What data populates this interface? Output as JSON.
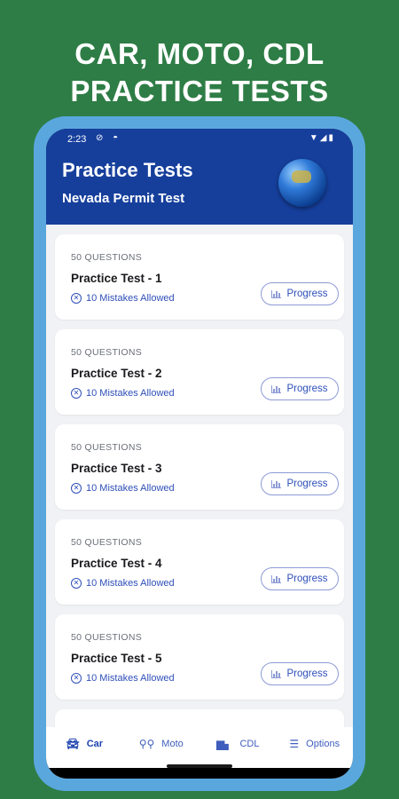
{
  "promo": {
    "line1": "CAR, MOTO, CDL",
    "line2": "PRACTICE TESTS"
  },
  "status_bar": {
    "time": "2:23",
    "left_icons": "⊘ ◓",
    "right_icons": "▼◢▮"
  },
  "header": {
    "title": "Practice Tests",
    "subtitle": "Nevada Permit Test"
  },
  "tests": [
    {
      "count": "50 QUESTIONS",
      "title": "Practice Test - 1",
      "mistakes": "10 Mistakes Allowed",
      "button": "Progress"
    },
    {
      "count": "50 QUESTIONS",
      "title": "Practice Test - 2",
      "mistakes": "10 Mistakes Allowed",
      "button": "Progress"
    },
    {
      "count": "50 QUESTIONS",
      "title": "Practice Test - 3",
      "mistakes": "10 Mistakes Allowed",
      "button": "Progress"
    },
    {
      "count": "50 QUESTIONS",
      "title": "Practice Test - 4",
      "mistakes": "10 Mistakes Allowed",
      "button": "Progress"
    },
    {
      "count": "50 QUESTIONS",
      "title": "Practice Test - 5",
      "mistakes": "10 Mistakes Allowed",
      "button": "Progress"
    }
  ],
  "nav": {
    "car": "Car",
    "moto": "Moto",
    "cdl": "CDL",
    "options": "Options"
  },
  "icons": {
    "car": "car-icon",
    "moto": "motorcycle-icon",
    "cdl": "truck-icon",
    "options": "menu-icon",
    "mistakes": "x-circle-icon",
    "progress": "bar-chart-icon"
  },
  "colors": {
    "background": "#2e7d46",
    "header": "#163f9c",
    "accent": "#2e4fb8",
    "phone_frame": "#5aa7de"
  }
}
